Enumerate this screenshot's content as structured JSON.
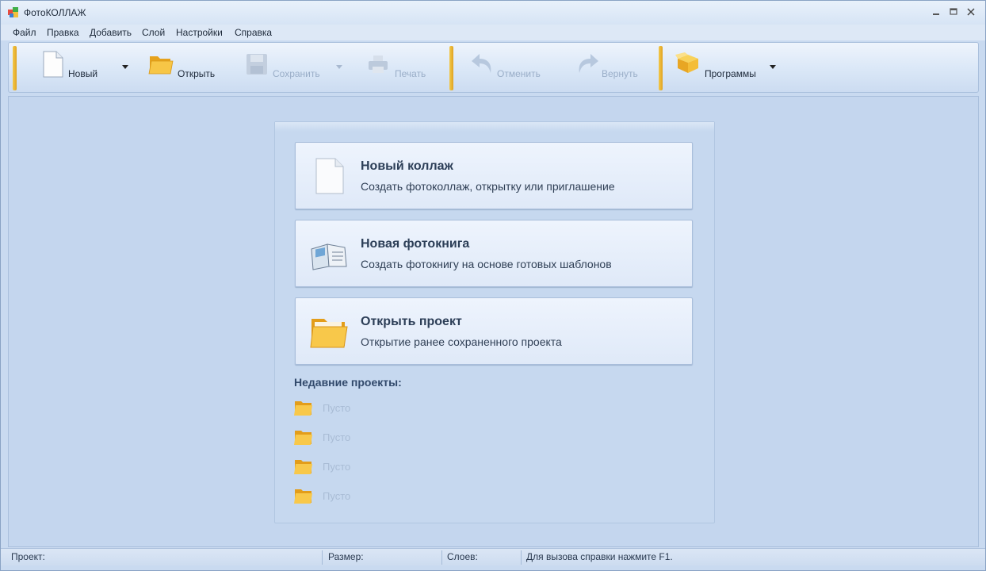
{
  "window": {
    "title": "ФотоКОЛЛАЖ"
  },
  "menu": [
    "Файл",
    "Правка",
    "Добавить",
    "Слой",
    "Настройки",
    "Справка"
  ],
  "toolbar": {
    "new_label": "Новый",
    "open_label": "Открыть",
    "save_label": "Сохранить",
    "print_label": "Печать",
    "undo_label": "Отменить",
    "redo_label": "Вернуть",
    "programs_label": "Программы"
  },
  "start_panel": {
    "cards": [
      {
        "title": "Новый коллаж",
        "desc": "Создать фотоколлаж, открытку или приглашение",
        "icon": "blank-page-icon"
      },
      {
        "title": "Новая фотокнига",
        "desc": "Создать фотокнигу на основе готовых шаблонов",
        "icon": "photobook-icon"
      },
      {
        "title": "Открыть проект",
        "desc": "Открытие ранее сохраненного проекта",
        "icon": "folder-icon"
      }
    ],
    "recent_title": "Недавние проекты:",
    "recent": [
      "Пусто",
      "Пусто",
      "Пусто",
      "Пусто"
    ]
  },
  "status": {
    "project": "Проект:",
    "size": "Размер:",
    "layers": "Слоев:",
    "help": "Для вызова справки нажмите F1."
  },
  "colors": {
    "accent": "#e0a322",
    "panel": "#c6d8ef",
    "title_text": "#2c3e57"
  }
}
